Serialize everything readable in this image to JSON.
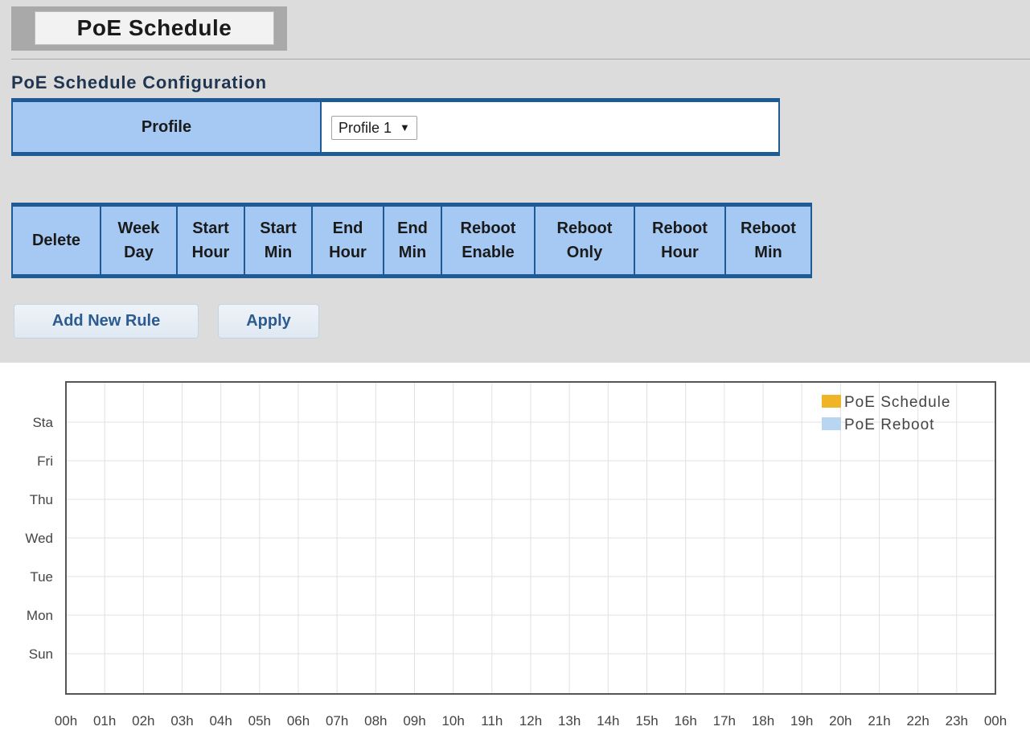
{
  "page": {
    "tab_title": "PoE Schedule",
    "section_title": "PoE Schedule Configuration"
  },
  "profile": {
    "label": "Profile",
    "selected": "Profile 1",
    "caret": "▼"
  },
  "rules_table": {
    "headers": [
      {
        "line1": "Delete",
        "line2": ""
      },
      {
        "line1": "Week",
        "line2": "Day"
      },
      {
        "line1": "Start",
        "line2": "Hour"
      },
      {
        "line1": "Start",
        "line2": "Min"
      },
      {
        "line1": "End",
        "line2": "Hour"
      },
      {
        "line1": "End",
        "line2": "Min"
      },
      {
        "line1": "Reboot",
        "line2": "Enable"
      },
      {
        "line1": "Reboot",
        "line2": "Only"
      },
      {
        "line1": "Reboot",
        "line2": "Hour"
      },
      {
        "line1": "Reboot",
        "line2": "Min"
      }
    ]
  },
  "buttons": {
    "add_new_rule": "Add New Rule",
    "apply": "Apply"
  },
  "chart_data": {
    "type": "heatmap",
    "days": [
      "Sta",
      "Fri",
      "Thu",
      "Wed",
      "Tue",
      "Mon",
      "Sun"
    ],
    "hours": [
      "00h",
      "01h",
      "02h",
      "03h",
      "04h",
      "05h",
      "06h",
      "07h",
      "08h",
      "09h",
      "10h",
      "11h",
      "12h",
      "13h",
      "14h",
      "15h",
      "16h",
      "17h",
      "18h",
      "19h",
      "20h",
      "21h",
      "22h",
      "23h",
      "00h"
    ],
    "series": [
      {
        "name": "PoE Schedule",
        "color": "#f0b429",
        "intervals": []
      },
      {
        "name": "PoE Reboot",
        "color": "#b8d6f2",
        "intervals": []
      }
    ],
    "grid": true,
    "legend": "top-right"
  }
}
